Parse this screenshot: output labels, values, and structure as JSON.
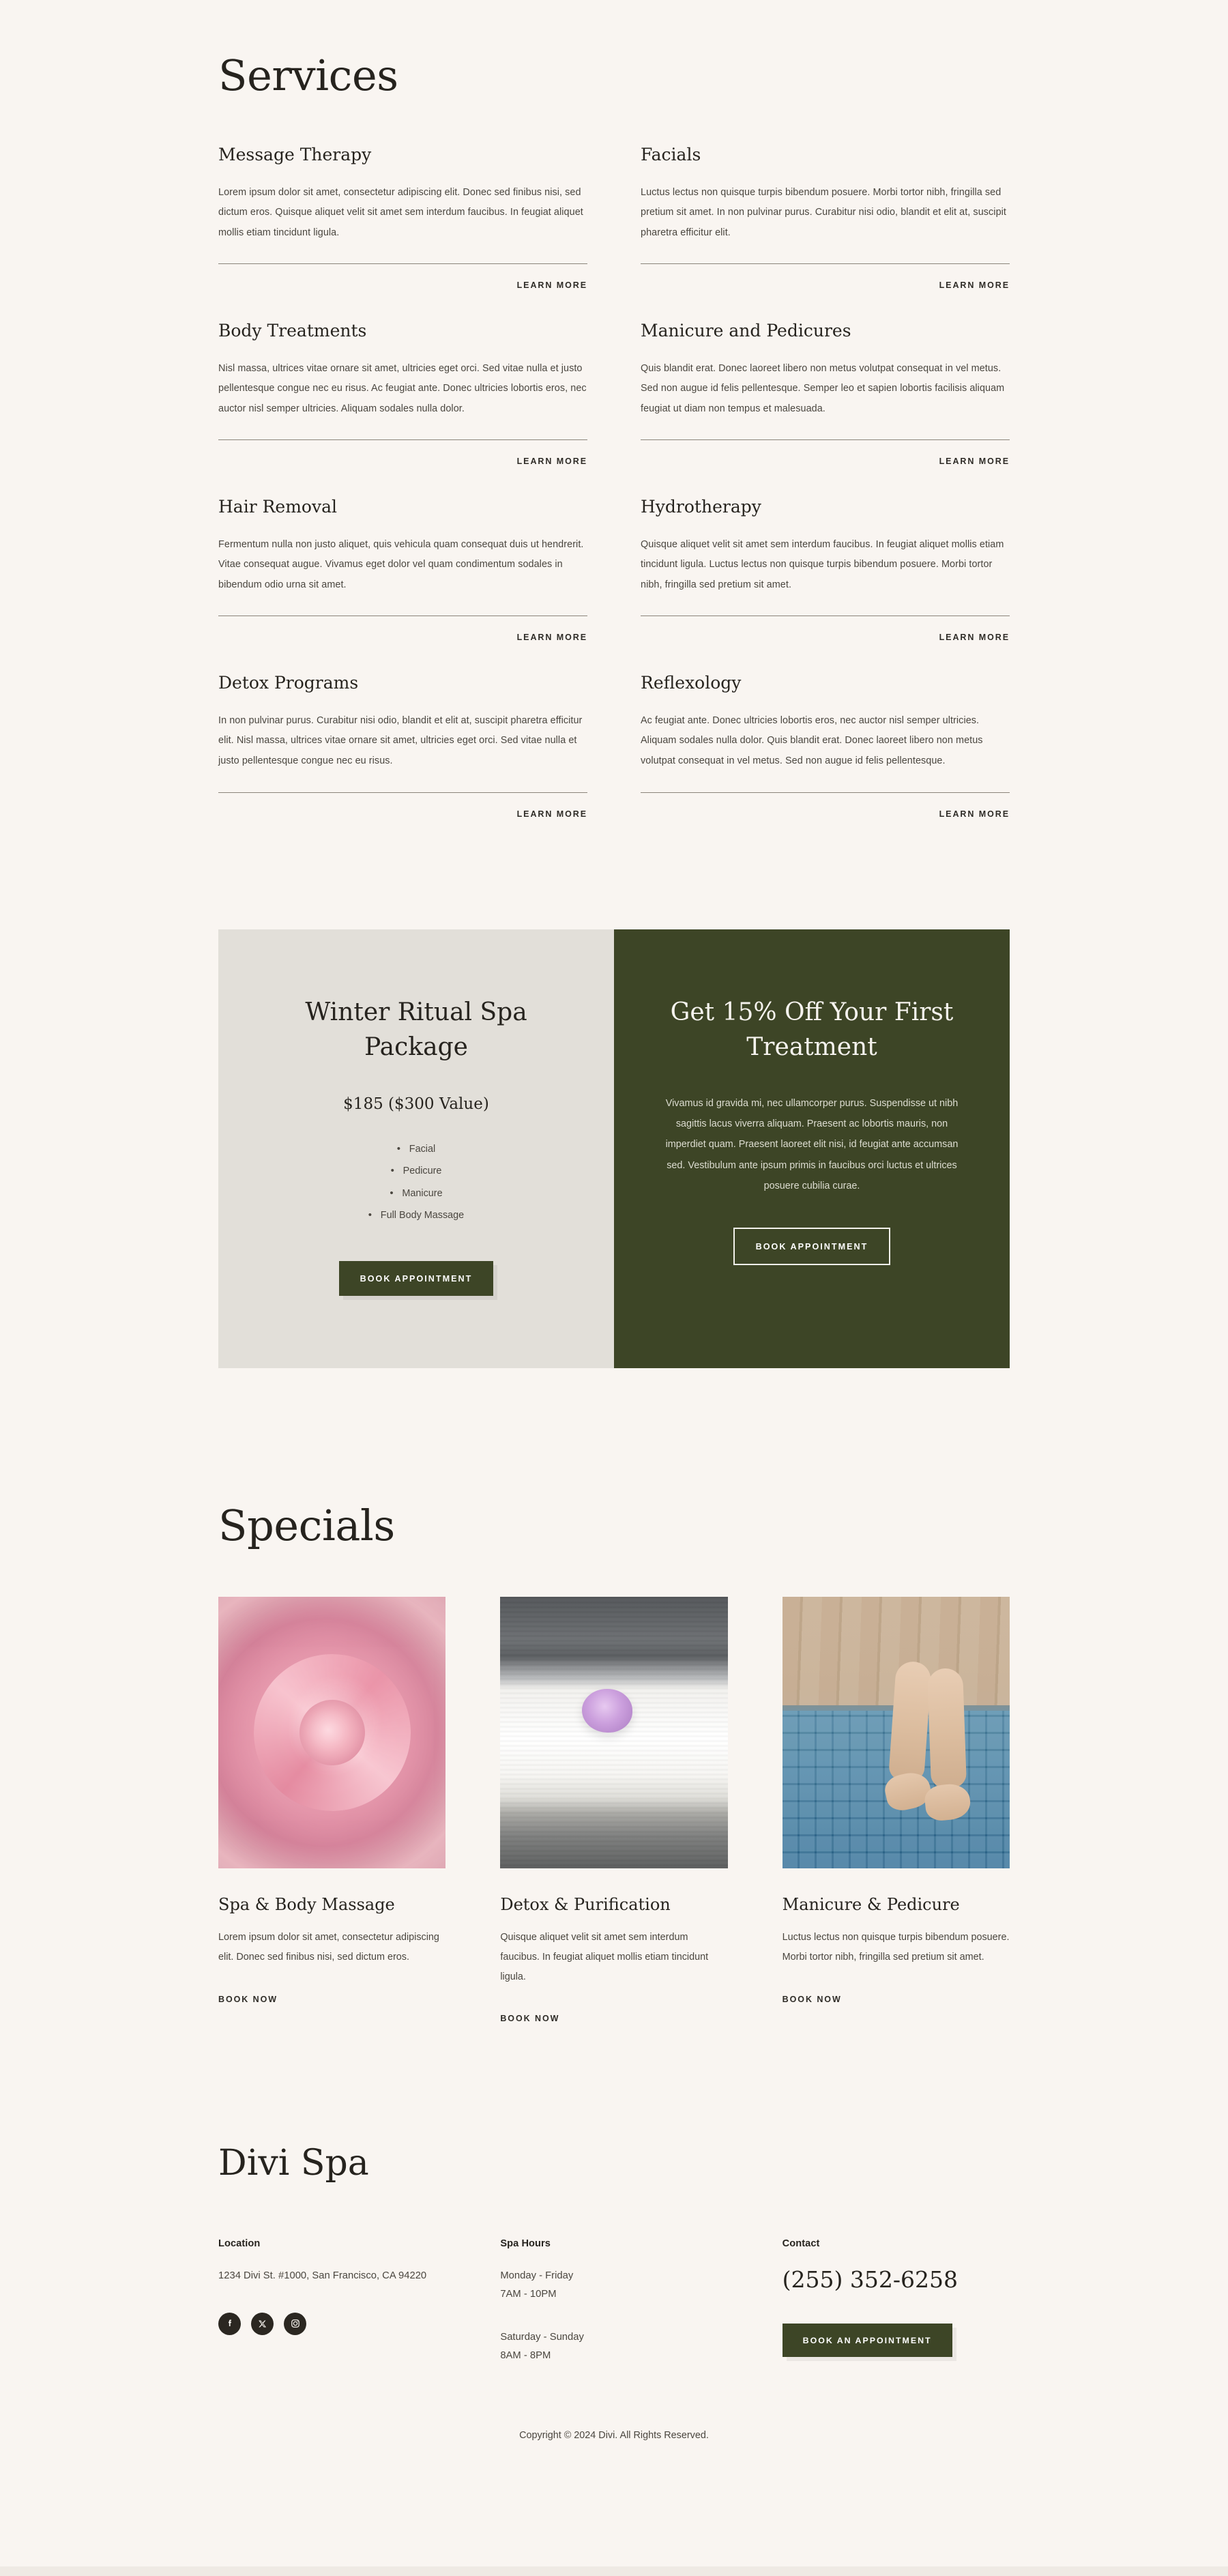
{
  "services": {
    "title": "Services",
    "learn_more_label": "LEARN MORE",
    "items": [
      {
        "title": "Message Therapy",
        "body": "Lorem ipsum dolor sit amet, consectetur adipiscing elit. Donec sed finibus nisi, sed dictum eros. Quisque aliquet velit sit amet sem interdum faucibus. In feugiat aliquet mollis etiam tincidunt ligula."
      },
      {
        "title": "Facials",
        "body": "Luctus lectus non quisque turpis bibendum posuere. Morbi tortor nibh, fringilla sed pretium sit amet. In non pulvinar purus. Curabitur nisi odio, blandit et elit at, suscipit pharetra efficitur elit."
      },
      {
        "title": "Body Treatments",
        "body": "Nisl massa, ultrices vitae ornare sit amet, ultricies eget orci. Sed vitae nulla et justo pellentesque congue nec eu risus. Ac feugiat ante. Donec ultricies lobortis eros, nec auctor nisl semper ultricies. Aliquam sodales nulla dolor."
      },
      {
        "title": "Manicure and Pedicures",
        "body": "Quis blandit erat. Donec laoreet libero non metus volutpat consequat in vel metus. Sed non augue id felis pellentesque. Semper leo et sapien lobortis facilisis aliquam feugiat ut diam non tempus et malesuada."
      },
      {
        "title": "Hair Removal",
        "body": "Fermentum nulla non justo aliquet, quis vehicula quam consequat duis ut hendrerit. Vitae consequat augue. Vivamus eget dolor vel quam condimentum sodales in bibendum odio urna sit amet."
      },
      {
        "title": "Hydrotherapy",
        "body": "Quisque aliquet velit sit amet sem interdum faucibus. In feugiat aliquet mollis etiam tincidunt ligula. Luctus lectus non quisque turpis bibendum posuere. Morbi tortor nibh, fringilla sed pretium sit amet."
      },
      {
        "title": "Detox Programs",
        "body": "In non pulvinar purus. Curabitur nisi odio, blandit et elit at, suscipit pharetra efficitur elit. Nisl massa, ultrices vitae ornare sit amet, ultricies eget orci. Sed vitae nulla et justo pellentesque congue nec eu risus."
      },
      {
        "title": "Reflexology",
        "body": "Ac feugiat ante. Donec ultricies lobortis eros, nec auctor nisl semper ultricies. Aliquam sodales nulla dolor. Quis blandit erat. Donec laoreet libero non metus volutpat consequat in vel metus. Sed non augue id felis pellentesque."
      }
    ]
  },
  "promo": {
    "left": {
      "title": "Winter Ritual Spa Package",
      "price": "$185 ($300 Value)",
      "includes": [
        "Facial",
        "Pedicure",
        "Manicure",
        "Full Body Massage"
      ],
      "cta": "BOOK APPOINTMENT",
      "bg_color": "#e2dfd9"
    },
    "right": {
      "title": "Get 15% Off Your First Treatment",
      "body": "Vivamus id gravida mi, nec ullamcorper purus. Suspendisse ut nibh sagittis lacus viverra aliquam. Praesent ac lobortis mauris, non imperdiet quam. Praesent laoreet elit nisi, id feugiat ante accumsan sed. Vestibulum ante ipsum primis in faucibus orci luctus et ultrices posuere cubilia curae.",
      "cta": "BOOK APPOINTMENT",
      "bg_color": "#3d4526"
    }
  },
  "specials": {
    "title": "Specials",
    "book_now_label": "BOOK NOW",
    "items": [
      {
        "image": "pink-rose-photo",
        "name": "Spa & Body Massage",
        "body": "Lorem ipsum dolor sit amet, consectetur adipiscing elit. Donec sed finibus nisi, sed dictum eros."
      },
      {
        "image": "folded-towel-with-orchid-photo",
        "name": "Detox & Purification",
        "body": "Quisque aliquet velit sit amet sem interdum faucibus. In feugiat aliquet mollis etiam tincidunt ligula."
      },
      {
        "image": "feet-by-pool-photo",
        "name": "Manicure & Pedicure",
        "body": "Luctus lectus non quisque turpis bibendum posuere. Morbi tortor nibh, fringilla sed pretium sit amet."
      }
    ]
  },
  "footer": {
    "brand": "Divi Spa",
    "location": {
      "heading": "Location",
      "address": "1234 Divi St. #1000, San Francisco, CA 94220"
    },
    "socials": [
      {
        "icon": "facebook-icon"
      },
      {
        "icon": "x-twitter-icon"
      },
      {
        "icon": "instagram-icon"
      }
    ],
    "hours": {
      "heading": "Spa Hours",
      "weekday_days": "Monday - Friday",
      "weekday_time": "7AM - 10PM",
      "weekend_days": "Saturday - Sunday",
      "weekend_time": "8AM - 8PM"
    },
    "contact": {
      "heading": "Contact",
      "phone": "(255) 352-6258",
      "cta": "BOOK AN APPOINTMENT"
    },
    "copyright": "Copyright © 2024 Divi. All Rights Reserved."
  },
  "theme": {
    "page_bg": "#f9f5f1",
    "accent_green": "#3d4526",
    "text_dark": "#26231e",
    "text_body": "#4a463f"
  }
}
